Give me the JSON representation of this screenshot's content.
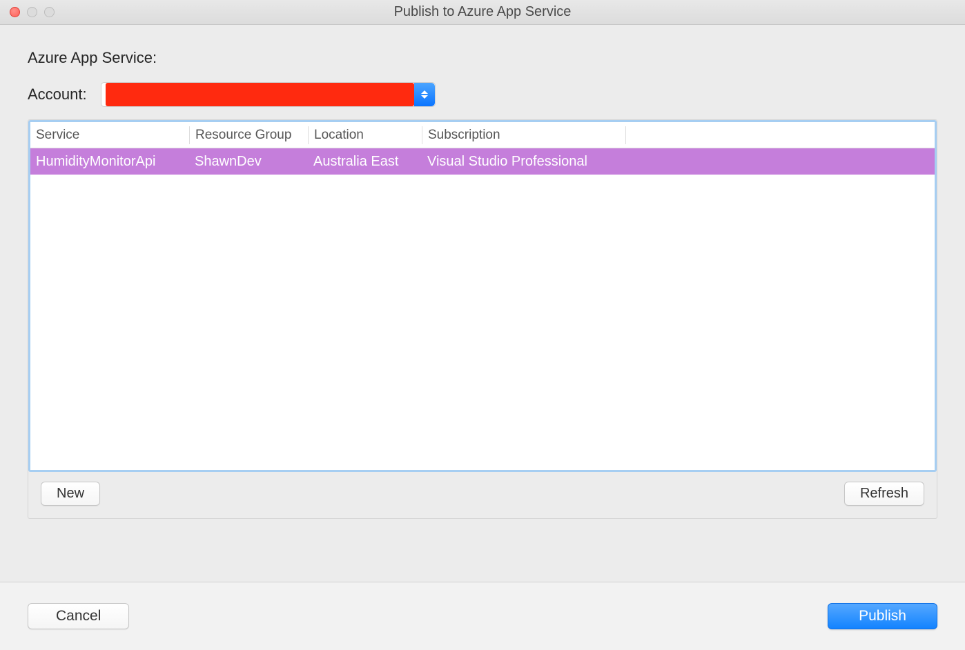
{
  "window": {
    "title": "Publish to Azure App Service"
  },
  "labels": {
    "section_title": "Azure App Service:",
    "account": "Account:"
  },
  "table": {
    "headers": {
      "service": "Service",
      "resource_group": "Resource Group",
      "location": "Location",
      "subscription": "Subscription"
    },
    "rows": [
      {
        "service": "HumidityMonitorApi",
        "resource_group": "ShawnDev",
        "location": "Australia East",
        "subscription": "Visual Studio Professional",
        "selected": true
      }
    ]
  },
  "buttons": {
    "new": "New",
    "refresh": "Refresh",
    "cancel": "Cancel",
    "publish": "Publish"
  },
  "colors": {
    "selection": "#c57edb",
    "primary": "#1383ff",
    "focus_border": "#a6cef2",
    "redaction": "#ff2a0f"
  }
}
